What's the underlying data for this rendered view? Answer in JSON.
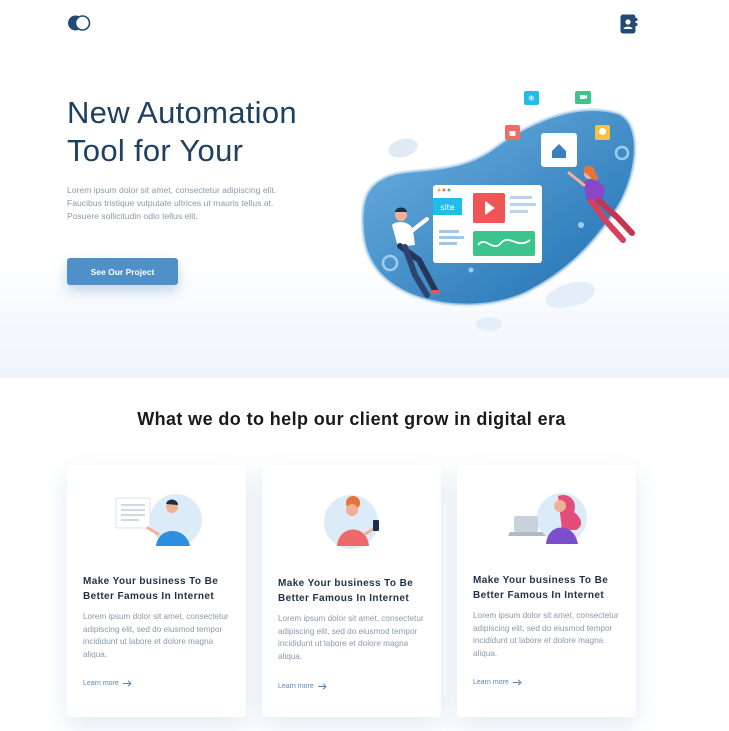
{
  "header": {
    "logo_icon": "toggle-logo-icon",
    "profile_icon": "contact-book-icon"
  },
  "hero": {
    "title_line1": "New Automation",
    "title_line2": "Tool for Your",
    "description": "Lorem ipsum dolor sit amet, consectetur adipiscing elit. Faucibus tristique vulputate ultrices ut mauris tellus at. Posuere sollicitudin odio tellus elit.",
    "cta_label": "See Our Project",
    "illustration": {
      "site_label": "site",
      "icons": [
        "snowflake-icon",
        "video-icon",
        "lock-icon",
        "bulb-icon",
        "home-icon",
        "play-icon"
      ]
    }
  },
  "services": {
    "title": "What we do to help our client grow in digital era",
    "cards": [
      {
        "title": "Make Your business To Be Better Famous In Internet",
        "text": "Lorem ipsum dolor sit amet, consectetur adipiscing elit, sed do eiusmod tempor incididunt ut labore et dolore magna aliqua.",
        "link": "Learn more",
        "art": "person-with-document-icon"
      },
      {
        "title": "Make Your business To Be Better Famous In Internet",
        "text": "Lorem ipsum dolor sit amet, consectetur adipiscing elit, sed do eiusmod tempor incididunt ut labore et dolore magna aliqua.",
        "link": "Learn more",
        "art": "person-with-phone-icon"
      },
      {
        "title": "Make Your business To Be Better Famous In Internet",
        "text": "Lorem ipsum dolor sit amet, consectetur adipiscing elit, sed do eiusmod tempor incididunt ut labore et dolore magna aliqua.",
        "link": "Learn more",
        "art": "person-with-laptop-icon"
      }
    ]
  },
  "colors": {
    "primary": "#4f90c9",
    "heading": "#20405f",
    "text_muted": "#8a99aa",
    "blob": "#3d8dc8"
  }
}
